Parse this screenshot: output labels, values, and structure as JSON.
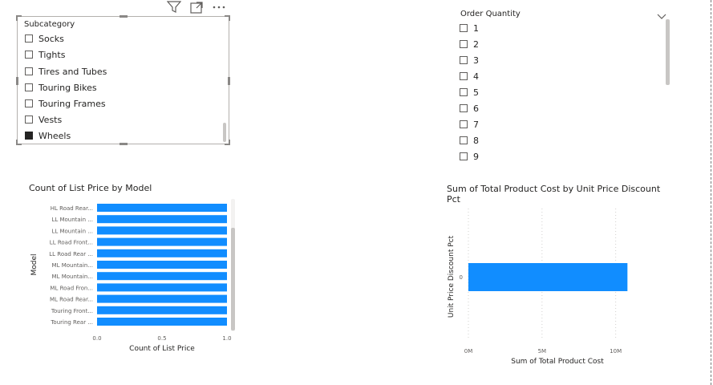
{
  "toolbar": {
    "filter_icon": "filter-icon",
    "focus_icon": "focus-mode-icon",
    "more_icon": "more-options-icon"
  },
  "slicer1": {
    "title": "Subcategory",
    "items": [
      {
        "label": "Socks",
        "checked": false
      },
      {
        "label": "Tights",
        "checked": false
      },
      {
        "label": "Tires and Tubes",
        "checked": false
      },
      {
        "label": "Touring Bikes",
        "checked": false
      },
      {
        "label": "Touring Frames",
        "checked": false
      },
      {
        "label": "Vests",
        "checked": false
      },
      {
        "label": "Wheels",
        "checked": true
      }
    ]
  },
  "slicer2": {
    "title": "Order Quantity",
    "items": [
      "1",
      "2",
      "3",
      "4",
      "5",
      "6",
      "7",
      "8",
      "9"
    ]
  },
  "chart1": {
    "title": "Count of List Price by Model",
    "chart_data": {
      "type": "bar",
      "orientation": "horizontal",
      "categories": [
        "HL Road Rear...",
        "LL Mountain ...",
        "LL Mountain ...",
        "LL Road Front...",
        "LL Road Rear ...",
        "ML Mountain...",
        "ML Mountain...",
        "ML Road Fron...",
        "ML Road Rear...",
        "Touring Front...",
        "Touring Rear ..."
      ],
      "values": [
        1,
        1,
        1,
        1,
        1,
        1,
        1,
        1,
        1,
        1,
        1
      ],
      "xlabel": "Count of List Price",
      "ylabel": "Model",
      "x_ticks": [
        "0.0",
        "0.5",
        "1.0"
      ],
      "xlim": [
        0,
        1
      ],
      "color": "#118DFF"
    }
  },
  "chart2": {
    "title_line1": "Sum of Total Product Cost by Unit Price Discount",
    "title_line2": "Pct",
    "chart_data": {
      "type": "bar",
      "orientation": "horizontal",
      "categories": [
        "0"
      ],
      "values": [
        10.8
      ],
      "value_unit": "M",
      "xlabel": "Sum of Total Product Cost",
      "ylabel": "Unit Price Discount Pct",
      "x_ticks": [
        "0M",
        "5M",
        "10M"
      ],
      "xlim": [
        0,
        11
      ],
      "color": "#118DFF"
    }
  }
}
